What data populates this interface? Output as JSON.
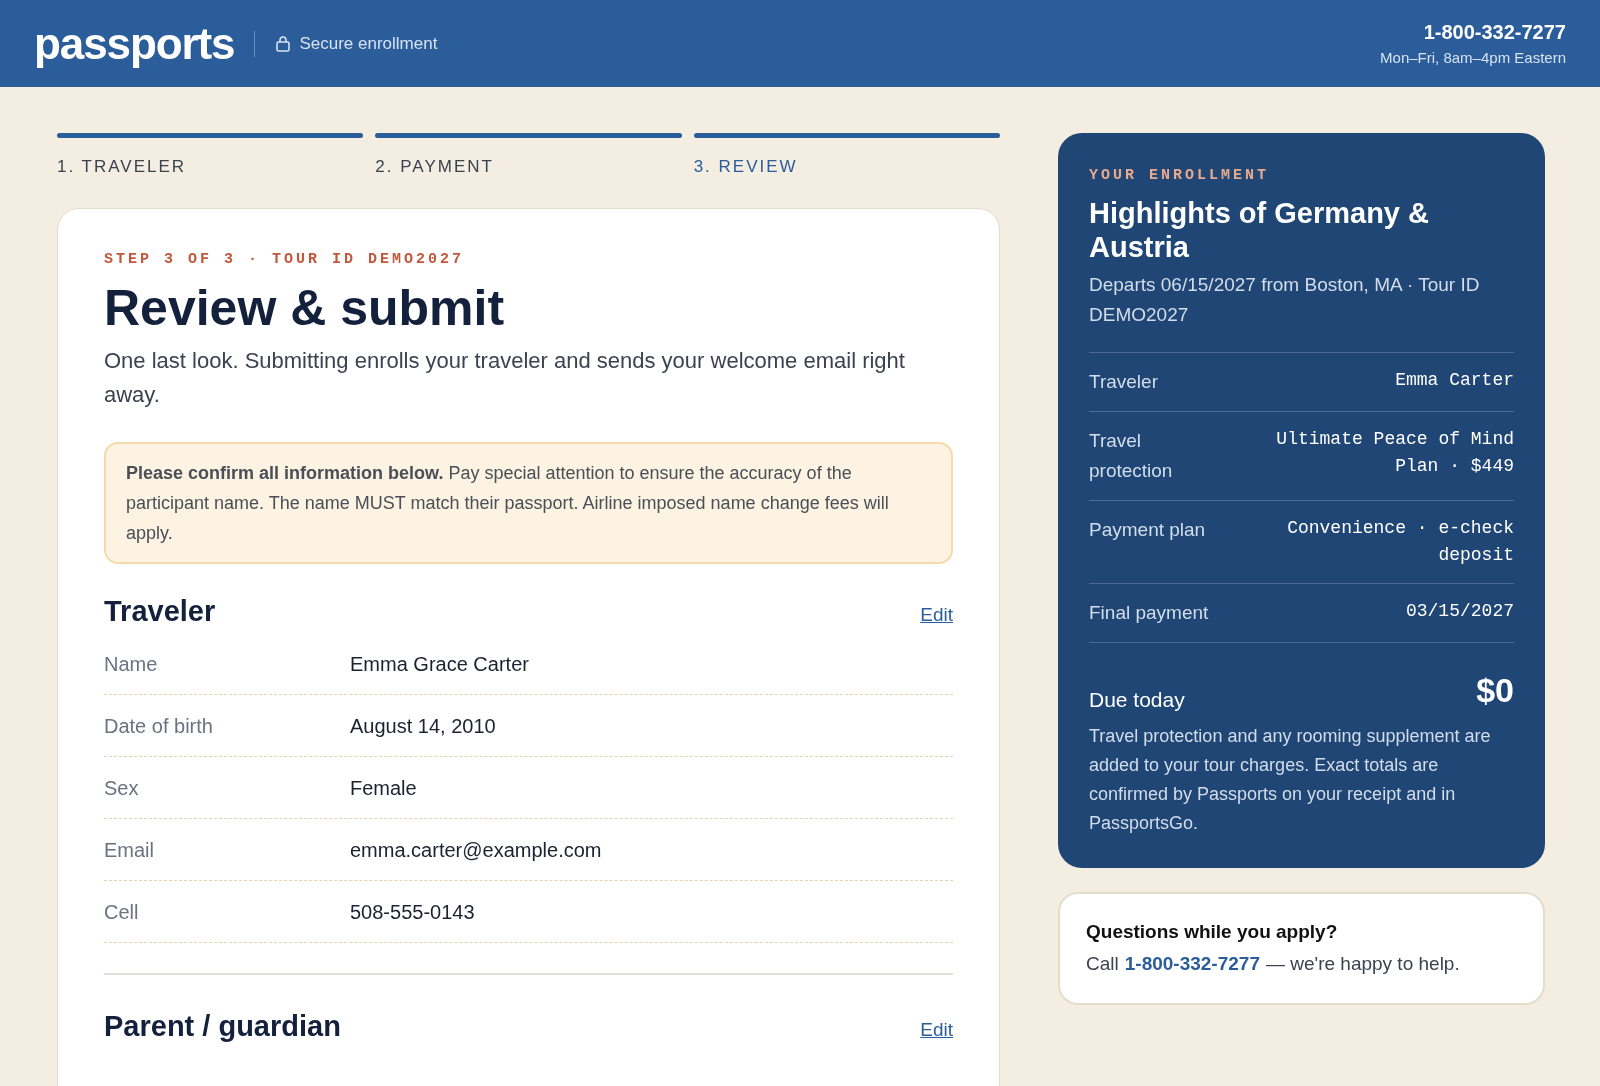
{
  "header": {
    "logo": "passports",
    "badge": "Secure enrollment",
    "phone": "1-800-332-7277",
    "hours": "Mon–Fri, 8am–4pm Eastern"
  },
  "steps": [
    {
      "label": "1. TRAVELER",
      "selected": false
    },
    {
      "label": "2. PAYMENT",
      "selected": false
    },
    {
      "label": "3. REVIEW",
      "selected": true
    }
  ],
  "main": {
    "eyebrow": "STEP 3 OF 3 · TOUR ID DEMO2027",
    "title": "Review & submit",
    "intro": "One last look. Submitting enrolls your traveler and sends your welcome email right away.",
    "notice": "**Please confirm all information below.** Pay special attention to ensure the accuracy of the participant name. The name MUST match their passport. Airline imposed name change fees will apply.",
    "sections": [
      {
        "title": "Traveler",
        "edit": "Edit",
        "rows": [
          {
            "label": "Name",
            "value": "Emma Grace Carter"
          },
          {
            "label": "Date of birth",
            "value": "August 14, 2010"
          },
          {
            "label": "Sex",
            "value": "Female"
          },
          {
            "label": "Email",
            "value": "emma.carter@example.com"
          },
          {
            "label": "Cell",
            "value": "508-555-0143"
          }
        ]
      },
      {
        "title": "Parent / guardian",
        "edit": "Edit"
      }
    ]
  },
  "summary": {
    "eyebrow": "YOUR ENROLLMENT",
    "title": "Highlights of Germany & Austria",
    "subtitle": "Departs 06/15/2027 from Boston, MA · Tour ID DEMO2027",
    "rows": [
      {
        "label": "Traveler",
        "value": "Emma Carter"
      },
      {
        "label": "Travel protection",
        "value": "Ultimate Peace of Mind Plan · $449"
      },
      {
        "label": "Payment plan",
        "value": "Convenience · e-check deposit"
      },
      {
        "label": "Final payment",
        "value": "03/15/2027"
      }
    ],
    "due_label": "Due today",
    "due_amount": "$0",
    "note": "Travel protection and any rooming supplement are added to your tour charges. Exact totals are confirmed by Passports on your receipt and in PassportsGo."
  },
  "help": {
    "title": "Questions while you apply?",
    "prefix": "Call",
    "link": "1-800-332-7277",
    "suffix": "— we're happy to help."
  }
}
